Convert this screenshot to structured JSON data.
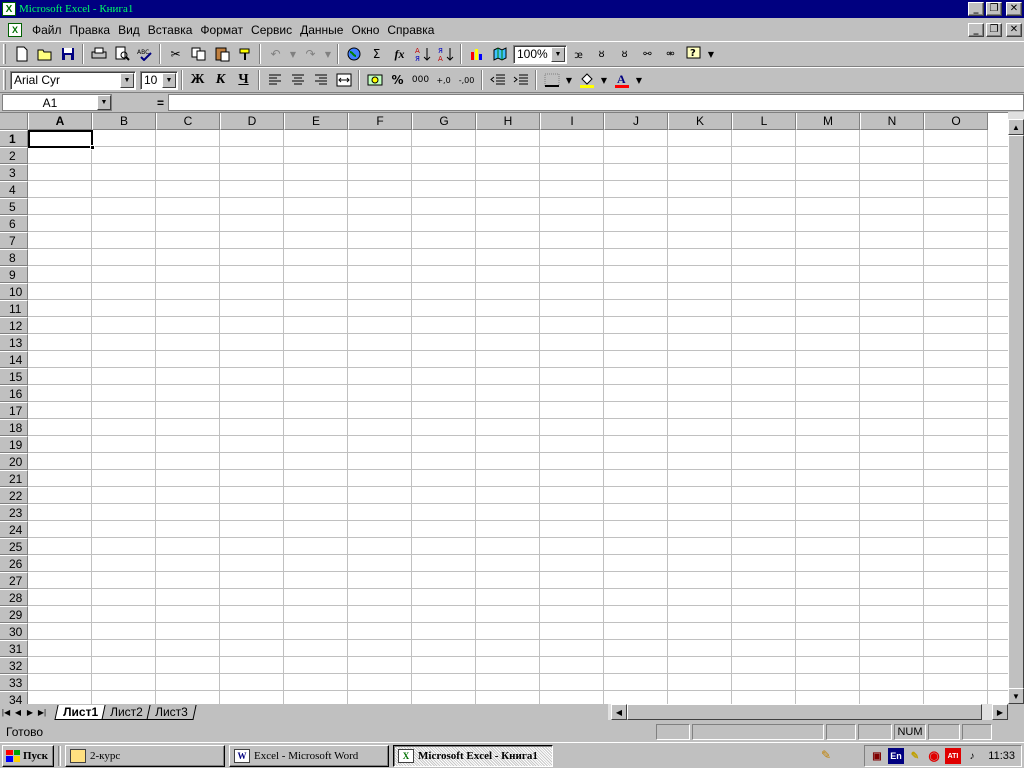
{
  "window": {
    "title": "Microsoft Excel - Книга1",
    "app_icon": "excel-icon"
  },
  "menubar": {
    "items": [
      "Файл",
      "Правка",
      "Вид",
      "Вставка",
      "Формат",
      "Сервис",
      "Данные",
      "Окно",
      "Справка"
    ]
  },
  "toolbar1": {
    "zoom": "100%",
    "sigma": "Σ",
    "fx": "fx"
  },
  "toolbar2": {
    "font_name": "Arial Cyr",
    "font_size": "10",
    "bold_label": "Ж",
    "italic_label": "К",
    "underline_label": "Ч",
    "percent": "%",
    "thousands": "000",
    "inc_decimal": "+,0",
    "dec_decimal": "-,00",
    "fill_color": "#ffff00",
    "font_color": "#ff0000"
  },
  "formulabar": {
    "name_box": "A1",
    "equals": "="
  },
  "grid": {
    "columns": [
      "A",
      "B",
      "C",
      "D",
      "E",
      "F",
      "G",
      "H",
      "I",
      "J",
      "K",
      "L",
      "M",
      "N",
      "O"
    ],
    "rows": [
      "1",
      "2",
      "3",
      "4",
      "5",
      "6",
      "7",
      "8",
      "9",
      "10",
      "11",
      "12",
      "13",
      "14",
      "15",
      "16",
      "17",
      "18",
      "19",
      "20",
      "21",
      "22",
      "23",
      "24",
      "25",
      "26",
      "27",
      "28",
      "29",
      "30",
      "31",
      "32",
      "33",
      "34"
    ],
    "active_cell": "A1"
  },
  "sheets": [
    "Лист1",
    "Лист2",
    "Лист3"
  ],
  "statusbar": {
    "ready": "Готово",
    "num": "NUM"
  },
  "taskbar": {
    "start": "Пуск",
    "buttons": [
      {
        "label": "2-курс",
        "icon": "folder-icon"
      },
      {
        "label": "Excel - Microsoft Word",
        "icon": "word-icon"
      },
      {
        "label": "Microsoft Excel - Книга1",
        "icon": "excel-icon"
      }
    ],
    "lang": "En",
    "clock": "11:33"
  }
}
